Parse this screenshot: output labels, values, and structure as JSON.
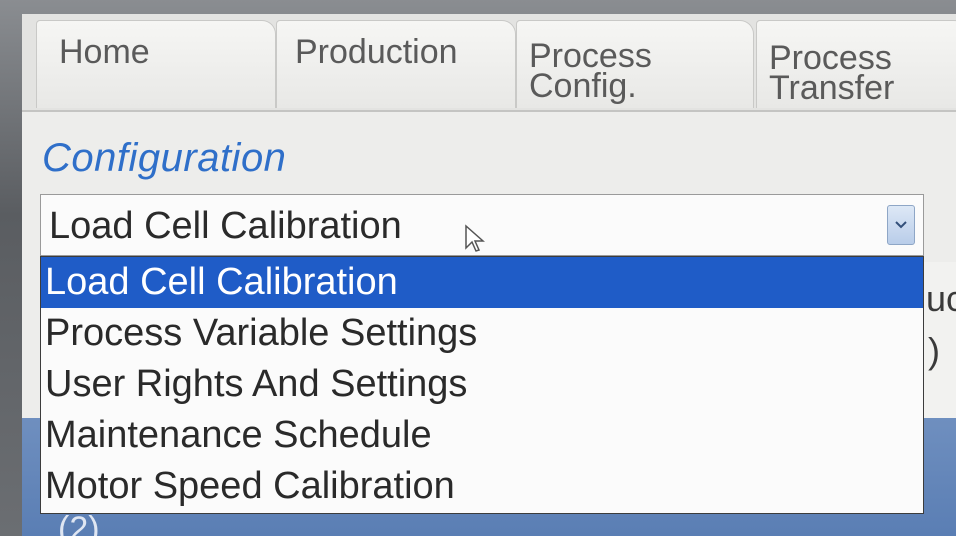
{
  "tabs": [
    {
      "label": "Home"
    },
    {
      "label": "Production"
    },
    {
      "label": "Process\nConfig."
    },
    {
      "label": "Process\nTransfer"
    }
  ],
  "section_title": "Configuration",
  "select": {
    "value": "Load Cell Calibration",
    "options": [
      "Load Cell Calibration",
      "Process Variable Settings",
      "User Rights And Settings",
      "Maintenance Schedule",
      "Motor Speed Calibration"
    ],
    "selected_index": 0
  },
  "partial_background_text": [
    "uc",
    ")",
    "(2)"
  ],
  "colors": {
    "title_blue": "#2f6fc9",
    "highlight": "#1f5cc7",
    "panel_blue": "#5a7eb4"
  },
  "icons": {
    "dropdown_arrow": "chevron-down-icon",
    "pointer": "mouse-pointer-icon"
  }
}
